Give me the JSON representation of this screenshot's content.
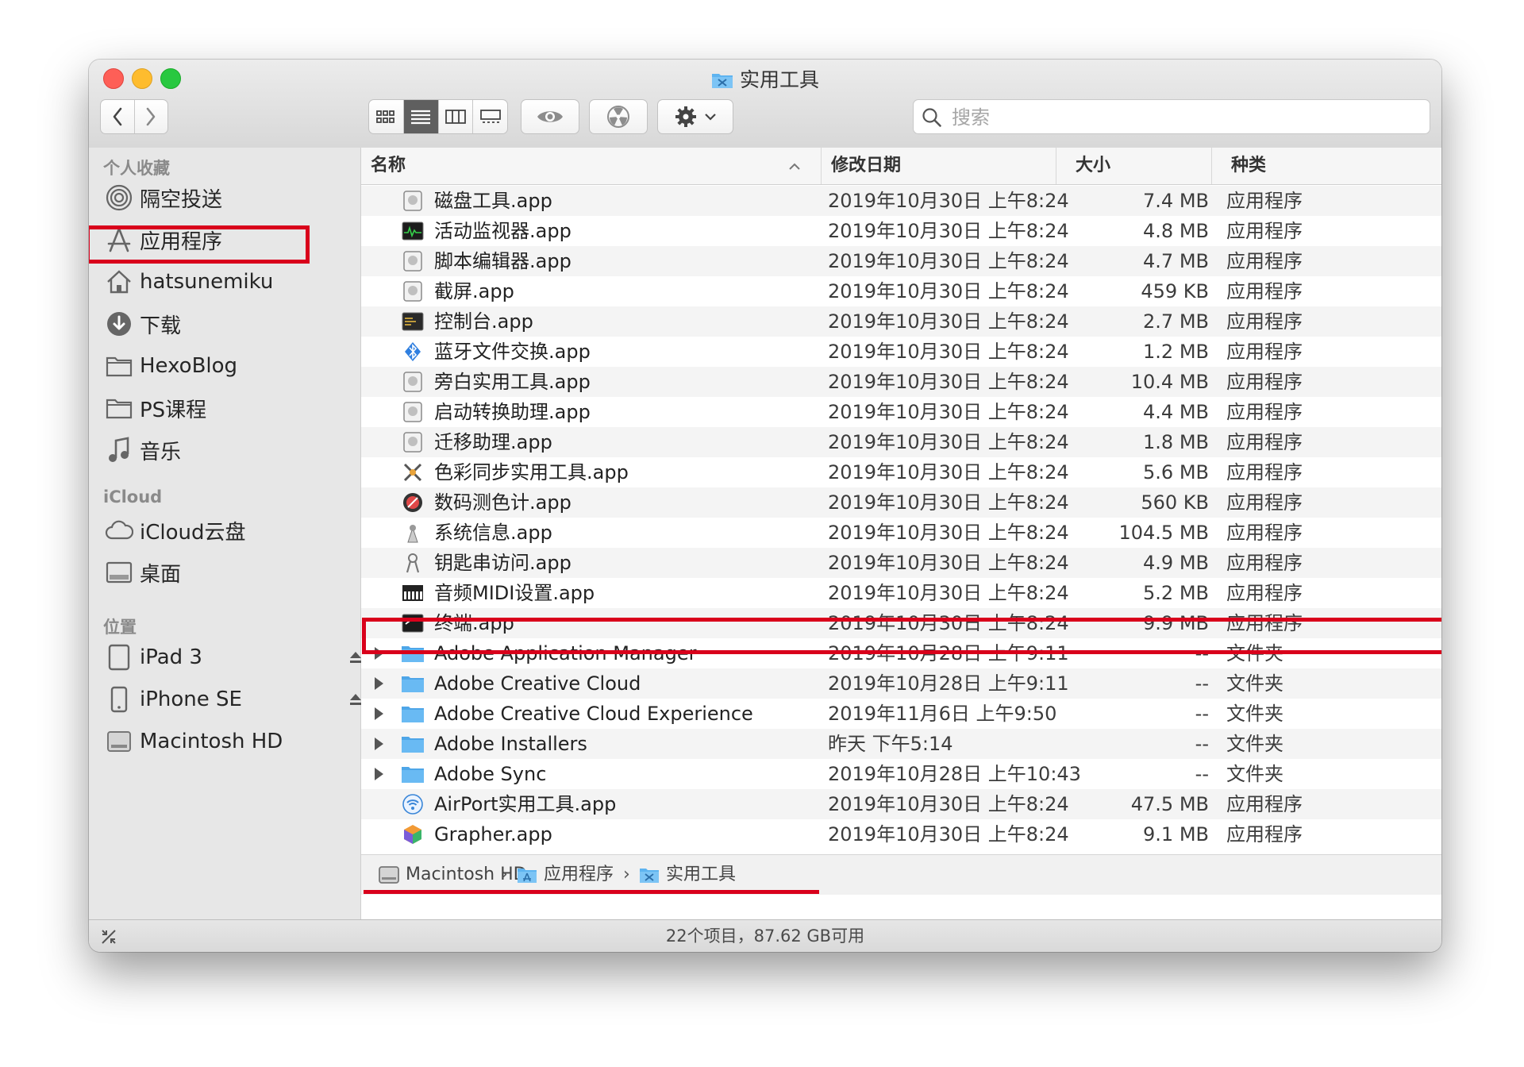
{
  "window": {
    "title": "实用工具"
  },
  "search": {
    "placeholder": "搜索"
  },
  "sidebar": {
    "favorites_heading": "个人收藏",
    "favorites": [
      {
        "label": "隔空投送",
        "icon": "airdrop-icon"
      },
      {
        "label": "应用程序",
        "icon": "applications-icon"
      },
      {
        "label": "hatsunemiku",
        "icon": "home-icon"
      },
      {
        "label": "下载",
        "icon": "downloads-icon"
      },
      {
        "label": "HexoBlog",
        "icon": "folder-icon"
      },
      {
        "label": "PS课程",
        "icon": "folder-icon"
      },
      {
        "label": "音乐",
        "icon": "music-icon"
      }
    ],
    "icloud_heading": "iCloud",
    "icloud": [
      {
        "label": "iCloud云盘",
        "icon": "cloud-icon"
      },
      {
        "label": "桌面",
        "icon": "desktop-icon"
      }
    ],
    "locations_heading": "位置",
    "locations": [
      {
        "label": "iPad 3",
        "icon": "ipad-icon",
        "eject": true
      },
      {
        "label": "iPhone SE",
        "icon": "iphone-icon",
        "eject": true
      },
      {
        "label": "Macintosh HD",
        "icon": "disk-icon",
        "eject": false
      }
    ]
  },
  "columns": {
    "name": "名称",
    "date": "修改日期",
    "size": "大小",
    "kind": "种类"
  },
  "files": [
    {
      "name": "磁盘工具.app",
      "date": "2019年10月30日 上午8:24",
      "size": "7.4 MB",
      "kind": "应用程序",
      "icon": "disk-utility-icon"
    },
    {
      "name": "活动监视器.app",
      "date": "2019年10月30日 上午8:24",
      "size": "4.8 MB",
      "kind": "应用程序",
      "icon": "activity-monitor-icon"
    },
    {
      "name": "脚本编辑器.app",
      "date": "2019年10月30日 上午8:24",
      "size": "4.7 MB",
      "kind": "应用程序",
      "icon": "script-editor-icon"
    },
    {
      "name": "截屏.app",
      "date": "2019年10月30日 上午8:24",
      "size": "459 KB",
      "kind": "应用程序",
      "icon": "screenshot-icon"
    },
    {
      "name": "控制台.app",
      "date": "2019年10月30日 上午8:24",
      "size": "2.7 MB",
      "kind": "应用程序",
      "icon": "console-icon"
    },
    {
      "name": "蓝牙文件交换.app",
      "date": "2019年10月30日 上午8:24",
      "size": "1.2 MB",
      "kind": "应用程序",
      "icon": "bluetooth-icon"
    },
    {
      "name": "旁白实用工具.app",
      "date": "2019年10月30日 上午8:24",
      "size": "10.4 MB",
      "kind": "应用程序",
      "icon": "voiceover-icon"
    },
    {
      "name": "启动转换助理.app",
      "date": "2019年10月30日 上午8:24",
      "size": "4.4 MB",
      "kind": "应用程序",
      "icon": "boot-camp-icon"
    },
    {
      "name": "迁移助理.app",
      "date": "2019年10月30日 上午8:24",
      "size": "1.8 MB",
      "kind": "应用程序",
      "icon": "migration-icon"
    },
    {
      "name": "色彩同步实用工具.app",
      "date": "2019年10月30日 上午8:24",
      "size": "5.6 MB",
      "kind": "应用程序",
      "icon": "colorsync-icon"
    },
    {
      "name": "数码测色计.app",
      "date": "2019年10月30日 上午8:24",
      "size": "560 KB",
      "kind": "应用程序",
      "icon": "color-meter-icon"
    },
    {
      "name": "系统信息.app",
      "date": "2019年10月30日 上午8:24",
      "size": "104.5 MB",
      "kind": "应用程序",
      "icon": "system-info-icon"
    },
    {
      "name": "钥匙串访问.app",
      "date": "2019年10月30日 上午8:24",
      "size": "4.9 MB",
      "kind": "应用程序",
      "icon": "keychain-icon"
    },
    {
      "name": "音频MIDI设置.app",
      "date": "2019年10月30日 上午8:24",
      "size": "5.2 MB",
      "kind": "应用程序",
      "icon": "midi-icon"
    },
    {
      "name": "终端.app",
      "date": "2019年10月30日 上午8:24",
      "size": "9.9 MB",
      "kind": "应用程序",
      "icon": "terminal-icon"
    },
    {
      "name": "Adobe Application Manager",
      "date": "2019年10月28日 上午9:11",
      "size": "--",
      "kind": "文件夹",
      "icon": "folder-icon",
      "folder": true
    },
    {
      "name": "Adobe Creative Cloud",
      "date": "2019年10月28日 上午9:11",
      "size": "--",
      "kind": "文件夹",
      "icon": "folder-icon",
      "folder": true
    },
    {
      "name": "Adobe Creative Cloud Experience",
      "date": "2019年11月6日 上午9:50",
      "size": "--",
      "kind": "文件夹",
      "icon": "folder-icon",
      "folder": true
    },
    {
      "name": "Adobe Installers",
      "date": "昨天 下午5:14",
      "size": "--",
      "kind": "文件夹",
      "icon": "folder-icon",
      "folder": true
    },
    {
      "name": "Adobe Sync",
      "date": "2019年10月28日 上午10:43",
      "size": "--",
      "kind": "文件夹",
      "icon": "folder-icon",
      "folder": true
    },
    {
      "name": "AirPort实用工具.app",
      "date": "2019年10月30日 上午8:24",
      "size": "47.5 MB",
      "kind": "应用程序",
      "icon": "airport-icon"
    },
    {
      "name": "Grapher.app",
      "date": "2019年10月30日 上午8:24",
      "size": "9.1 MB",
      "kind": "应用程序",
      "icon": "grapher-icon"
    }
  ],
  "pathbar": [
    "Macintosh HD",
    "应用程序",
    "实用工具"
  ],
  "status": "22个项目，87.62 GB可用",
  "colors": {
    "highlight": "#d9001b",
    "folder": "#5eb4f0",
    "selected_segment": "#5f5f5f"
  }
}
